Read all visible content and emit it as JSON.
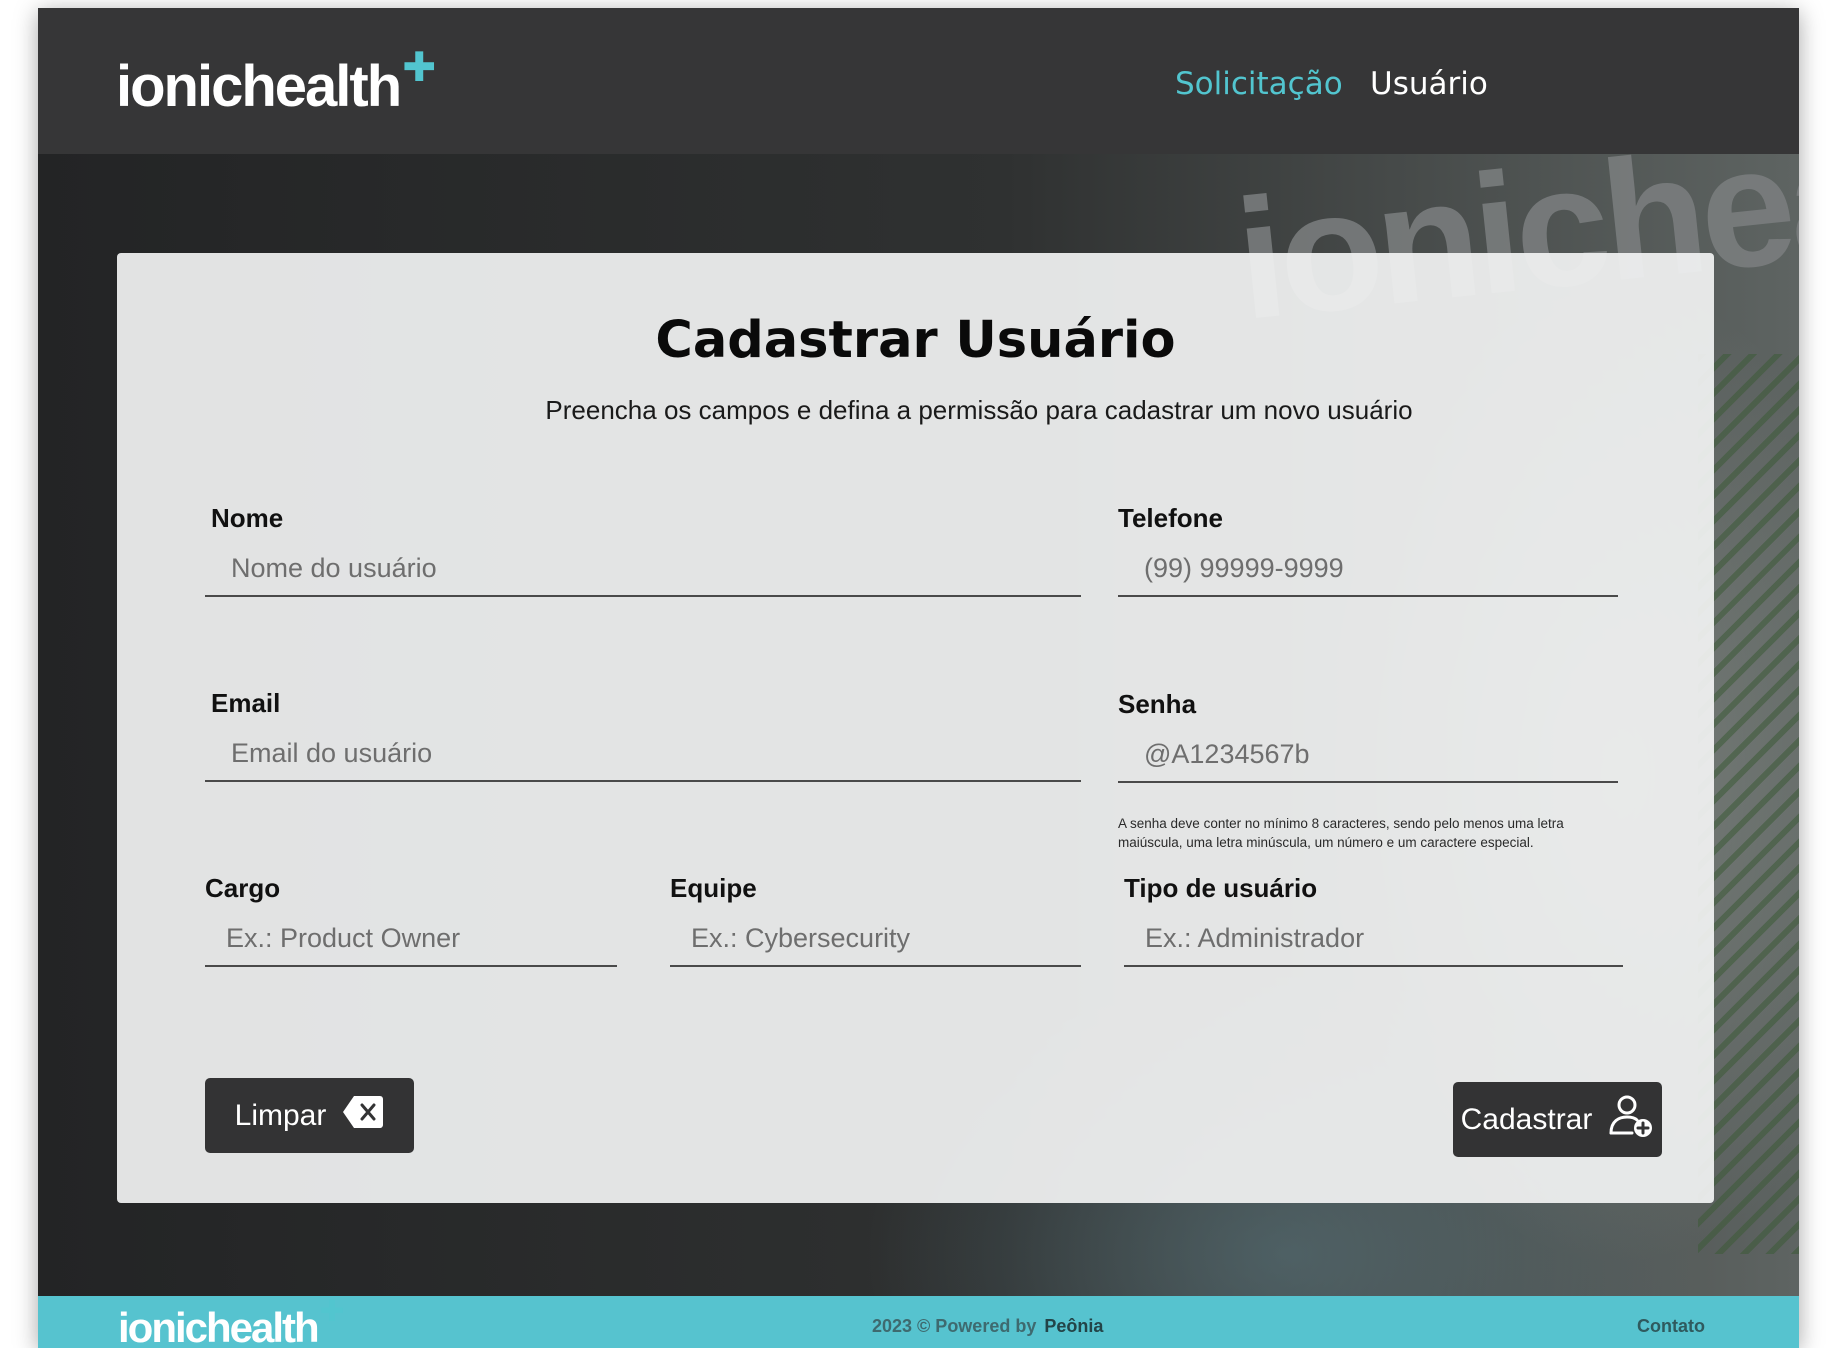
{
  "header": {
    "logo_text": "ionichealth",
    "nav": [
      {
        "label": "Solicitação",
        "active": true
      },
      {
        "label": "Usuário",
        "active": false
      }
    ]
  },
  "background": {
    "wordmark": "ionichea"
  },
  "form": {
    "title": "Cadastrar Usuário",
    "subtitle": "Preencha os campos e defina a permissão para cadastrar um novo usuário",
    "fields": {
      "nome": {
        "label": "Nome",
        "placeholder": "Nome do usuário",
        "value": ""
      },
      "telefone": {
        "label": "Telefone",
        "placeholder": "(99) 99999-9999",
        "value": ""
      },
      "email": {
        "label": "Email",
        "placeholder": "Email do usuário",
        "value": ""
      },
      "senha": {
        "label": "Senha",
        "placeholder": "@A1234567b",
        "value": ""
      },
      "cargo": {
        "label": "Cargo",
        "placeholder": "Ex.: Product Owner",
        "value": ""
      },
      "equipe": {
        "label": "Equipe",
        "placeholder": "Ex.: Cybersecurity",
        "value": ""
      },
      "tipo": {
        "label": "Tipo de usuário",
        "placeholder": "Ex.: Administrador",
        "value": ""
      }
    },
    "password_hint": "A senha deve conter no mínimo 8 caracteres, sendo pelo menos uma letra maiúscula, uma letra minúscula, um número e um caractere especial.",
    "buttons": {
      "clear_label": "Limpar",
      "clear_icon": "backspace-icon",
      "submit_label": "Cadastrar",
      "submit_icon": "user-add-icon"
    }
  },
  "footer": {
    "logo_text": "ionichealth",
    "powered_text": "2023 © Powered by",
    "powered_brand": "Peônia",
    "contact_label": "Contato"
  },
  "colors": {
    "accent": "#52c5cf",
    "header_bg": "#363637",
    "button_bg": "#333334",
    "footer_bg": "#56c3cf"
  }
}
